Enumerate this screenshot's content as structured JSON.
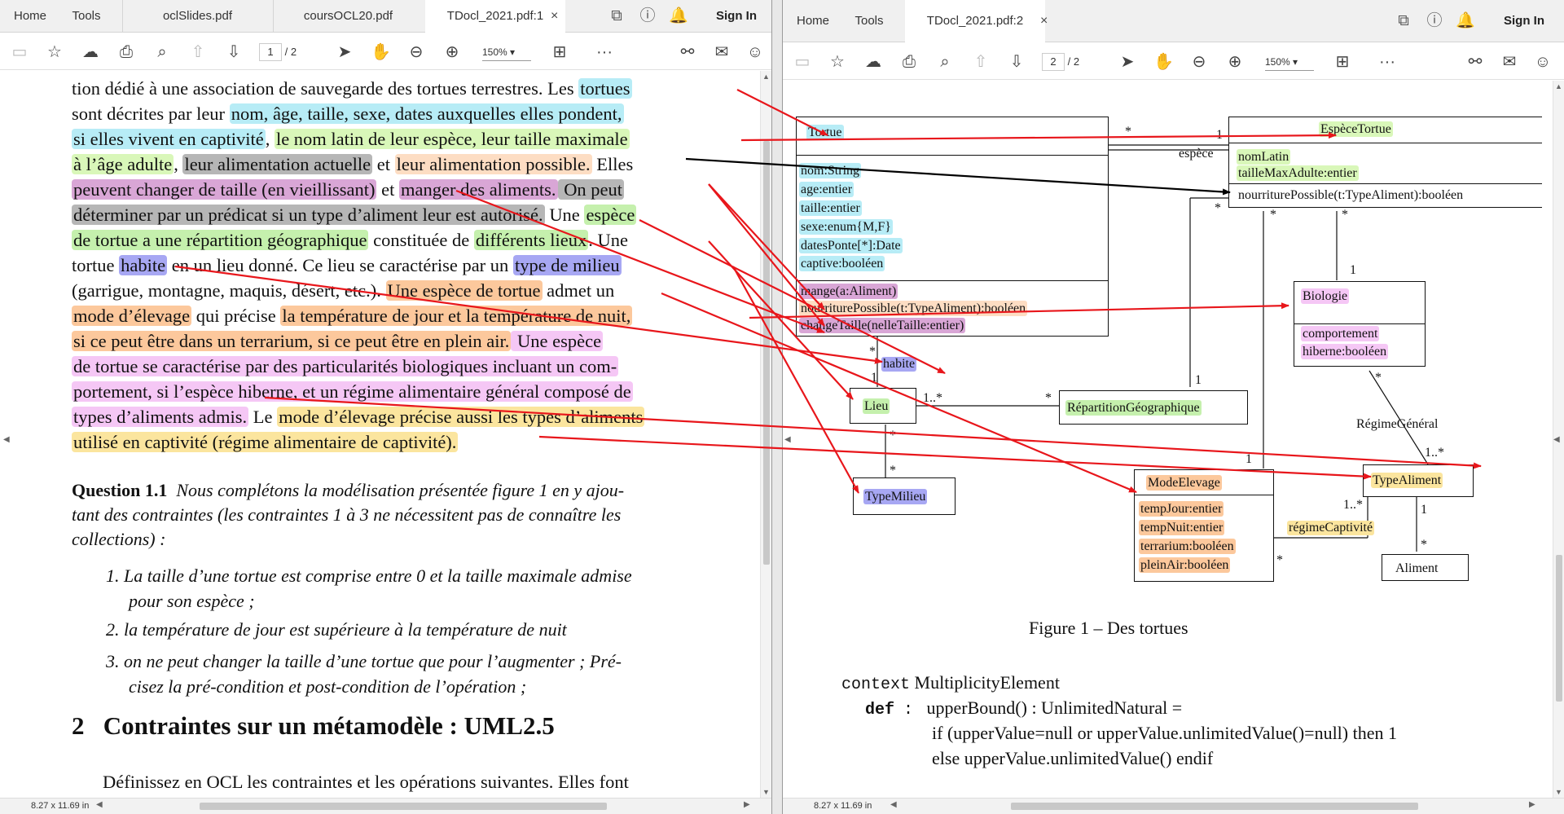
{
  "left": {
    "tabs": {
      "home": "Home",
      "tools": "Tools",
      "tab1": "oclSlides.pdf",
      "tab2": "coursOCL20.pdf",
      "tab3": "TDocl_2021.pdf:1",
      "sign_in": "Sign In"
    },
    "page": {
      "current": "1",
      "total": "/ 2",
      "zoom": "150%"
    },
    "status": "8.27 x 11.69 in",
    "text": {
      "l1a": "tion dédié à une association de sauvegarde des tortues terrestres. Les ",
      "l1b": "tortues",
      "l2a": "sont décrites par leur ",
      "l2b": "nom, âge, taille, sexe, dates auxquelles elles pondent,",
      "l3a": "si elles vivent en captivité",
      "l3b": ", ",
      "l3c": "le nom latin de leur espèce, leur taille maximale",
      "l4a": "à l’âge adulte",
      "l4b": ", ",
      "l4c": "leur alimentation actuelle",
      "l4d": " et ",
      "l4e": "leur alimentation possible.",
      "l4f": " Elles",
      "l5a": "peuvent changer de taille (en vieillissant)",
      "l5b": " et ",
      "l5c": "manger des aliments.",
      "l5d": " On peut",
      "l6a": "déterminer par un prédicat si un type d’aliment leur est autorisé.",
      "l6b": " Une ",
      "l6c": "espèce",
      "l7a": "de tortue a une répartition géographique",
      "l7b": " constituée de ",
      "l7c": "différents lieux",
      "l7d": ". Une",
      "l8a": "tortue ",
      "l8b": "habite",
      "l8c": " en un lieu donné. Ce lieu se caractérise par un ",
      "l8d": "type de milieu",
      "l9a": "(garrigue, montagne, maquis, désert, etc.). ",
      "l9b": "Une espèce de tortue",
      "l9c": " admet un",
      "l10a": "mode d’élevage",
      "l10b": " qui précise ",
      "l10c": "la température de jour et la température de nuit,",
      "l11a": "si ce peut être dans un terrarium, si ce peut être en plein air.",
      "l11b": " Une espèce",
      "l12a": "de tortue se caractérise par des particularités biologiques incluant un com-",
      "l13a": "portement, si l’espèce hiberne, et un régime alimentaire général composé de",
      "l14a": "types d’aliments admis.",
      "l14b": " Le ",
      "l14c": "mode d’élevage précise aussi les types d’aliments",
      "l15a": "utilisé en captivité (régime alimentaire de captivité)."
    },
    "question": {
      "label": "Question 1.1",
      "text1": "Nous complétons la modélisation présentée figure 1 en y ajou-",
      "text2": "tant des contraintes (les contraintes 1 à 3 ne nécessitent pas de connaître les",
      "text3": "collections) :",
      "items": [
        {
          "num": "1.",
          "text": "La taille d’une tortue est comprise entre 0 et la taille maximale admise",
          "cont": "pour son espèce ;"
        },
        {
          "num": "2.",
          "text": "la température de jour est supérieure à la température de nuit",
          "cont": ""
        },
        {
          "num": "3.",
          "text": "on ne peut changer la taille d’une tortue que pour l’augmenter ; Pré-",
          "cont": "cisez la pré-condition et post-condition de l’opération ;"
        }
      ]
    },
    "section": {
      "num": "2",
      "title": "Contraintes sur un métamodèle : UML2.5"
    },
    "last_para": "Définissez en OCL les contraintes et les opérations suivantes. Elles font"
  },
  "right": {
    "tabs": {
      "home": "Home",
      "tools": "Tools",
      "tab1": "TDocl_2021.pdf:2",
      "sign_in": "Sign In"
    },
    "page": {
      "current": "2",
      "total": "/ 2",
      "zoom": "150%"
    },
    "status": "8.27 x 11.69 in",
    "uml": {
      "tortue": {
        "name": "Tortue",
        "attrs": [
          "nom:String",
          "age:entier",
          "taille:entier",
          "sexe:enum{M,F}",
          "datesPonte[*]:Date",
          "captive:booléen"
        ],
        "ops": [
          "mange(a:Aliment)",
          "nourriturePossible(t:TypeAliment):booléen",
          "changeTaille(nelleTaille:entier)"
        ]
      },
      "espece": {
        "name": "EspèceTortue",
        "attrs": [
          "nomLatin",
          "tailleMaxAdulte:entier"
        ],
        "ops": [
          "nourriturePossible(t:TypeAliment):booléen"
        ]
      },
      "biologie": {
        "name": "Biologie",
        "attrs": [
          "comportement",
          "hiberne:booléen"
        ]
      },
      "lieu": {
        "name": "Lieu"
      },
      "repartition": {
        "name": "RépartitionGéographique"
      },
      "typemilieu": {
        "name": "TypeMilieu"
      },
      "modeelevage": {
        "name": "ModeElevage",
        "attrs": [
          "tempJour:entier",
          "tempNuit:entier",
          "terrarium:booléen",
          "pleinAir:booléen"
        ]
      },
      "typealiment": {
        "name": "TypeAliment"
      },
      "aliment": {
        "name": "Aliment"
      },
      "labels": {
        "espece": "espèce",
        "habite": "habite",
        "regime_general": "RégimeGénéral",
        "regime_captivite": "régimeCaptivité"
      },
      "mult": {
        "star": "*",
        "one": "1",
        "one_star": "1..*"
      }
    },
    "figure_caption": "Figure 1 – Des tortues",
    "code": {
      "kw1": "context",
      "ctx": "MultiplicityElement",
      "kw2": "def",
      "colon": ":",
      "l1": "upperBound() : UnlimitedNatural =",
      "l2": "if (upperValue=null or upperValue.unlimitedValue()=null) then 1",
      "l3": "else upperValue.unlimitedValue() endif"
    }
  },
  "colors": {
    "cyan": "#b7ecf6",
    "lime": "#d9f7b9",
    "grey": "#b6b6b6",
    "purple": "#d9a6d6",
    "green": "#c5f0ad",
    "blue": "#a7a7f3",
    "orange": "#fcc89c",
    "pink": "#f5c7f5",
    "yellow": "#fbe59e",
    "arrow_red": "#e8161b",
    "arrow_black": "#000000"
  }
}
